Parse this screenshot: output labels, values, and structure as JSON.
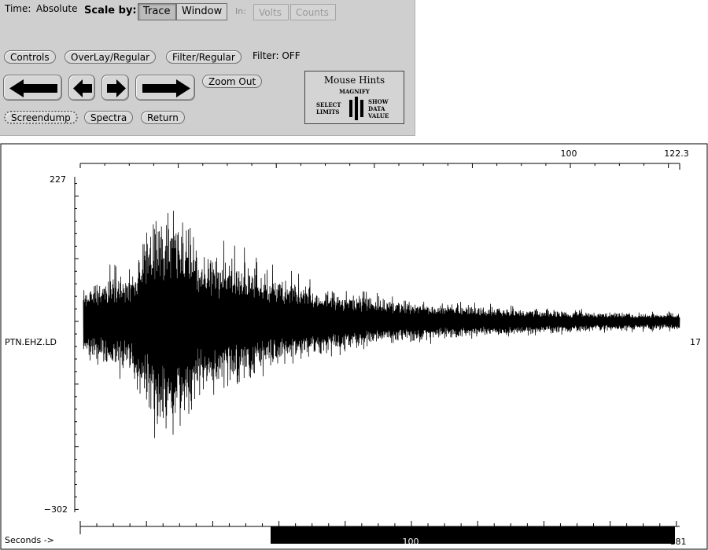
{
  "controls": {
    "time_label": "Time:",
    "time_value": "Absolute",
    "scale_label": "Scale by:",
    "scale_options": [
      "Trace",
      "Window"
    ],
    "scale_selected": "Trace",
    "in_label": "In:",
    "unit_options": [
      "Volts",
      "Counts"
    ],
    "buttons": {
      "controls": "Controls",
      "overlay": "OverLay/Regular",
      "filter": "Filter/Regular",
      "zoom_out": "Zoom Out",
      "screendump": "Screendump",
      "spectra": "Spectra",
      "return": "Return"
    },
    "filter_status": "Filter: OFF",
    "nav_icons": [
      "arrow-left-large",
      "arrow-left-small",
      "arrow-right-small",
      "arrow-right-large"
    ]
  },
  "mouse_hints": {
    "title": "Mouse Hints",
    "middle": "MAGNIFY",
    "left": [
      "SELECT",
      "LIMITS"
    ],
    "right": [
      "SHOW",
      "DATA",
      "VALUE"
    ]
  },
  "chart_data": {
    "type": "line",
    "title": "",
    "trace_label": "PTN.EHZ.LD",
    "right_value": "17",
    "y_axis": {
      "max_label": "227",
      "min_label": "−302",
      "range": [
        -302,
        227
      ]
    },
    "top_axis": {
      "tick_labels": [
        "100",
        "122.3"
      ],
      "range": [
        0,
        122.3
      ]
    },
    "bottom_axis": {
      "label": "Seconds ->",
      "tick_labels": [
        "100",
        "181"
      ],
      "range": [
        0,
        181
      ]
    },
    "envelope_notes": "waveform amplitude envelope (in counts) by fraction of displayed time window",
    "envelope": [
      {
        "t": 0.0,
        "amp": 70
      },
      {
        "t": 0.04,
        "amp": 90
      },
      {
        "t": 0.08,
        "amp": 100
      },
      {
        "t": 0.12,
        "amp": 230
      },
      {
        "t": 0.16,
        "amp": 210
      },
      {
        "t": 0.2,
        "amp": 140
      },
      {
        "t": 0.25,
        "amp": 130
      },
      {
        "t": 0.32,
        "amp": 90
      },
      {
        "t": 0.4,
        "amp": 65
      },
      {
        "t": 0.5,
        "amp": 45
      },
      {
        "t": 0.6,
        "amp": 35
      },
      {
        "t": 0.7,
        "amp": 28
      },
      {
        "t": 0.8,
        "amp": 22
      },
      {
        "t": 0.9,
        "amp": 18
      },
      {
        "t": 1.0,
        "amp": 16
      }
    ]
  }
}
